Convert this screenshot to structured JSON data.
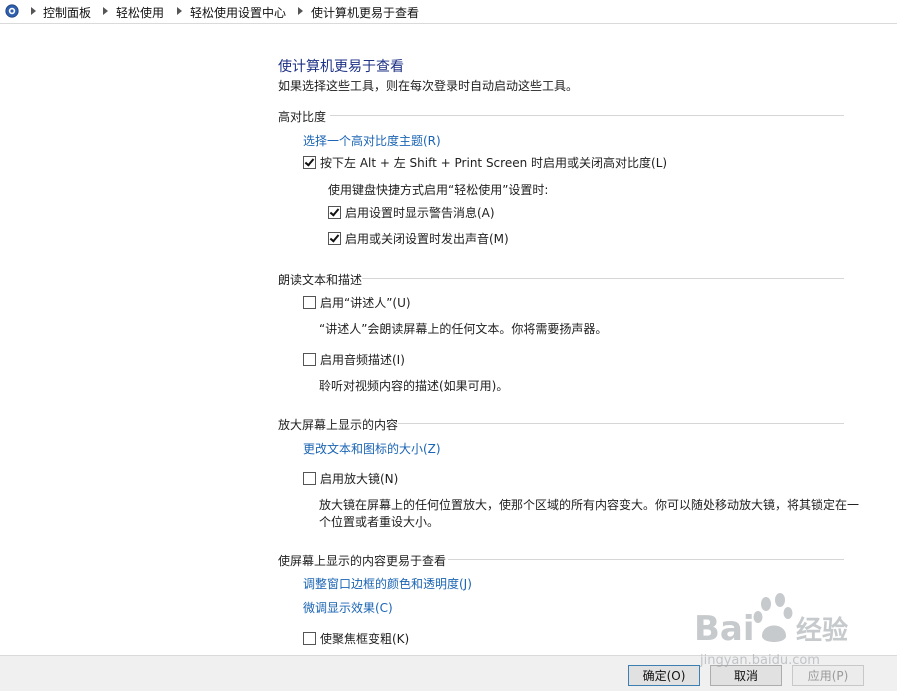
{
  "breadcrumb": {
    "items": [
      "控制面板",
      "轻松使用",
      "轻松使用设置中心",
      "使计算机更易于查看"
    ]
  },
  "page": {
    "title": "使计算机更易于查看",
    "subtitle": "如果选择这些工具，则在每次登录时自动启动这些工具。"
  },
  "sections": {
    "high_contrast": {
      "header": "高对比度",
      "link": "选择一个高对比度主题(R)",
      "toggle_label": "按下左 Alt + 左 Shift + Print Screen 时启用或关闭高对比度(L)",
      "toggle_checked": true,
      "keyboard_note": "使用键盘快捷方式启用“轻松使用”设置时:",
      "warn_label": "启用设置时显示警告消息(A)",
      "warn_checked": true,
      "sound_label": "启用或关闭设置时发出声音(M)",
      "sound_checked": true
    },
    "narrator": {
      "header": "朗读文本和描述",
      "narrator_label": "启用“讲述人”(U)",
      "narrator_checked": false,
      "narrator_desc": "“讲述人”会朗读屏幕上的任何文本。你将需要扬声器。",
      "audio_desc_label": "启用音频描述(I)",
      "audio_desc_checked": false,
      "audio_desc_desc": "聆听对视频内容的描述(如果可用)。"
    },
    "magnify": {
      "header": "放大屏幕上显示的内容",
      "link": "更改文本和图标的大小(Z)",
      "magnifier_label": "启用放大镜(N)",
      "magnifier_checked": false,
      "magnifier_desc": "放大镜在屏幕上的任何位置放大，使那个区域的所有内容变大。你可以随处移动放大镜，将其锁定在一个位置或者重设大小。"
    },
    "easier_view": {
      "header": "使屏幕上显示的内容更易于查看",
      "link_colors": "调整窗口边框的颜色和透明度(J)",
      "link_effects": "微调显示效果(C)",
      "focus_label": "使聚焦框变粗(K)",
      "focus_checked": false
    }
  },
  "footer": {
    "ok": "确定(O)",
    "cancel": "取消",
    "apply": "应用(P)"
  },
  "watermark": {
    "brand": "Bai",
    "brand_tail": "经验",
    "url": "jingyan.baidu.com"
  },
  "colors": {
    "title": "#1e3287",
    "link": "#1a64b4",
    "divider": "#d6d6d6",
    "footer_bg": "#f0f0f0"
  }
}
